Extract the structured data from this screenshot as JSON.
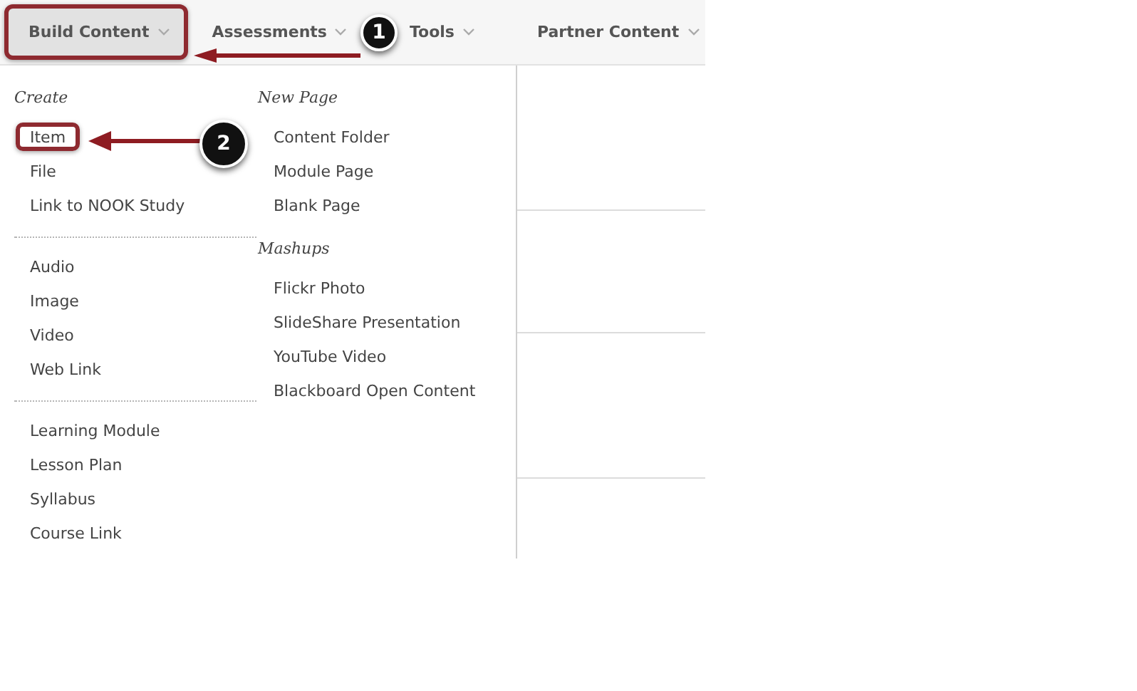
{
  "tabs": [
    {
      "label": "Build Content",
      "selected": true,
      "highlighted": true
    },
    {
      "label": "Assessments",
      "selected": false,
      "highlighted": false
    },
    {
      "label": "Tools",
      "selected": false,
      "highlighted": false
    },
    {
      "label": "Partner Content",
      "selected": false,
      "highlighted": false
    }
  ],
  "menu": {
    "columns": [
      {
        "sections": [
          {
            "heading": "Create",
            "items": [
              {
                "label": "Item",
                "highlighted": true
              },
              {
                "label": "File",
                "highlighted": false
              },
              {
                "label": "Link to NOOK Study",
                "highlighted": false
              }
            ]
          },
          {
            "items": [
              {
                "label": "Audio",
                "highlighted": false
              },
              {
                "label": "Image",
                "highlighted": false
              },
              {
                "label": "Video",
                "highlighted": false
              },
              {
                "label": "Web Link",
                "highlighted": false
              }
            ]
          },
          {
            "items": [
              {
                "label": "Learning Module",
                "highlighted": false
              },
              {
                "label": "Lesson Plan",
                "highlighted": false
              },
              {
                "label": "Syllabus",
                "highlighted": false
              },
              {
                "label": "Course Link",
                "highlighted": false
              }
            ]
          }
        ]
      },
      {
        "sections": [
          {
            "heading": "New Page",
            "items": [
              {
                "label": "Content Folder",
                "highlighted": false
              },
              {
                "label": "Module Page",
                "highlighted": false
              },
              {
                "label": "Blank Page",
                "highlighted": false
              }
            ]
          },
          {
            "heading": "Mashups",
            "items": [
              {
                "label": "Flickr Photo",
                "highlighted": false
              },
              {
                "label": "SlideShare Presentation",
                "highlighted": false
              },
              {
                "label": "YouTube Video",
                "highlighted": false
              },
              {
                "label": "Blackboard Open Content",
                "highlighted": false
              }
            ]
          }
        ]
      }
    ]
  },
  "callouts": [
    {
      "number": "1"
    },
    {
      "number": "2"
    }
  ]
}
